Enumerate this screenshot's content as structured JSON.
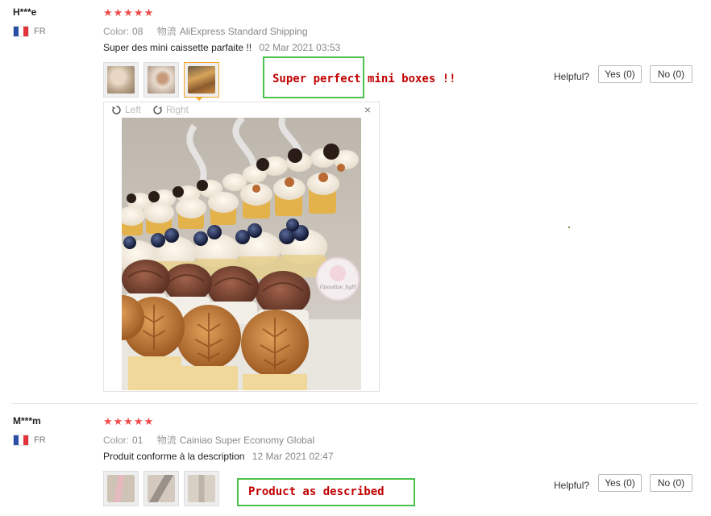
{
  "reviews": [
    {
      "user": "H***e",
      "country": "FR",
      "stars": "★★★★★",
      "color_label": "Color:",
      "color_value": "08",
      "shipping_label": "物流",
      "shipping_value": "AliExpress Standard Shipping",
      "text": "Super des mini caissette parfaite !!",
      "date": "02 Mar 2021 03:53",
      "annotation": "Super perfect mini boxes !!",
      "helpful_label": "Helpful?",
      "yes_label": "Yes (0)",
      "no_label": "No (0)",
      "viewer": {
        "left_label": "Left",
        "right_label": "Right",
        "close": "×"
      },
      "photo_watermark": "Opaudise_bgH"
    },
    {
      "user": "M***m",
      "country": "FR",
      "stars": "★★★★★",
      "color_label": "Color:",
      "color_value": "01",
      "shipping_label": "物流",
      "shipping_value": "Cainiao Super Economy Global",
      "text": "Produit conforme à la description",
      "date": "12 Mar 2021 02:47",
      "annotation": "Product as described",
      "helpful_label": "Helpful?",
      "yes_label": "Yes (0)",
      "no_label": "No (0)"
    }
  ],
  "colors": {
    "star": "#f04a4a",
    "annotation_border": "#4cc24c",
    "annotation_text": "#c10000",
    "active_thumb": "#f5a623"
  }
}
